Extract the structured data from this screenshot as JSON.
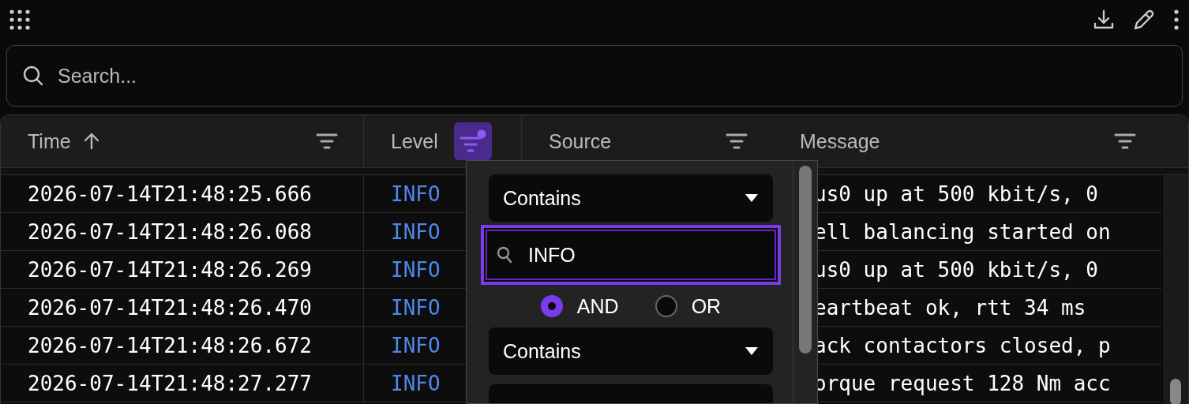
{
  "search": {
    "placeholder": "Search..."
  },
  "table": {
    "columns": [
      {
        "label": "Time",
        "sorted": true,
        "filter_active": false
      },
      {
        "label": "Level",
        "sorted": false,
        "filter_active": true
      },
      {
        "label": "Source",
        "sorted": false,
        "filter_active": false
      },
      {
        "label": "Message",
        "sorted": false,
        "filter_active": false
      }
    ],
    "rows": [
      {
        "time": "2026-07-14T21:48:25.666",
        "level": "INFO",
        "message": "us0 up at 500 kbit/s, 0"
      },
      {
        "time": "2026-07-14T21:48:26.068",
        "level": "INFO",
        "message": "ell balancing started on"
      },
      {
        "time": "2026-07-14T21:48:26.269",
        "level": "INFO",
        "message": "us0 up at 500 kbit/s, 0"
      },
      {
        "time": "2026-07-14T21:48:26.470",
        "level": "INFO",
        "message": "eartbeat ok, rtt 34 ms"
      },
      {
        "time": "2026-07-14T21:48:26.672",
        "level": "INFO",
        "message": "ack contactors closed, p"
      },
      {
        "time": "2026-07-14T21:48:27.277",
        "level": "INFO",
        "message": "orque request 128 Nm acc"
      }
    ]
  },
  "filter_popup": {
    "operator_1": "Contains",
    "value_1": "INFO",
    "joins": [
      {
        "label": "AND",
        "selected": true
      },
      {
        "label": "OR",
        "selected": false
      }
    ],
    "operator_2": "Contains"
  }
}
